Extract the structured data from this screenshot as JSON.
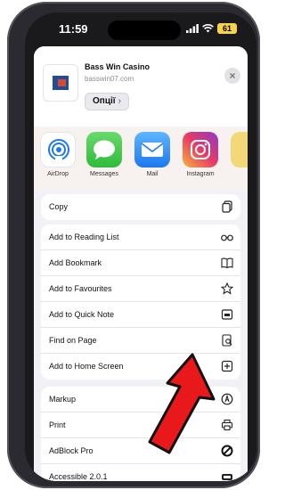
{
  "status_bar": {
    "time": "11:59",
    "battery": "61"
  },
  "header": {
    "title": "Bass Win Casino",
    "url": "basswin07.com",
    "options_label": "Опції",
    "options_chevron": "›",
    "close": "×"
  },
  "apps": [
    {
      "label": "AirDrop",
      "icon": "airdrop-icon"
    },
    {
      "label": "Messages",
      "icon": "messages-icon"
    },
    {
      "label": "Mail",
      "icon": "mail-icon"
    },
    {
      "label": "Instagram",
      "icon": "instagram-icon"
    },
    {
      "label": "",
      "icon": "notes-app-icon"
    }
  ],
  "actions_group1": [
    {
      "label": "Copy",
      "icon": "copy-icon"
    }
  ],
  "actions_group2": [
    {
      "label": "Add to Reading List",
      "icon": "glasses-icon"
    },
    {
      "label": "Add Bookmark",
      "icon": "book-icon"
    },
    {
      "label": "Add to Favourites",
      "icon": "star-icon"
    },
    {
      "label": "Add to Quick Note",
      "icon": "quick-note-icon"
    },
    {
      "label": "Find on Page",
      "icon": "find-icon"
    },
    {
      "label": "Add to Home Screen",
      "icon": "add-square-icon"
    }
  ],
  "actions_group3": [
    {
      "label": "Markup",
      "icon": "markup-icon"
    },
    {
      "label": "Print",
      "icon": "print-icon"
    },
    {
      "label": "AdBlock Pro",
      "icon": "block-icon"
    },
    {
      "label": "Accessible 2.0.1",
      "icon": "accessible-icon"
    }
  ],
  "colors": {
    "sheet_bg": "#f2f2f6",
    "arrow": "#e8181b",
    "accent": "#1c78ef"
  }
}
